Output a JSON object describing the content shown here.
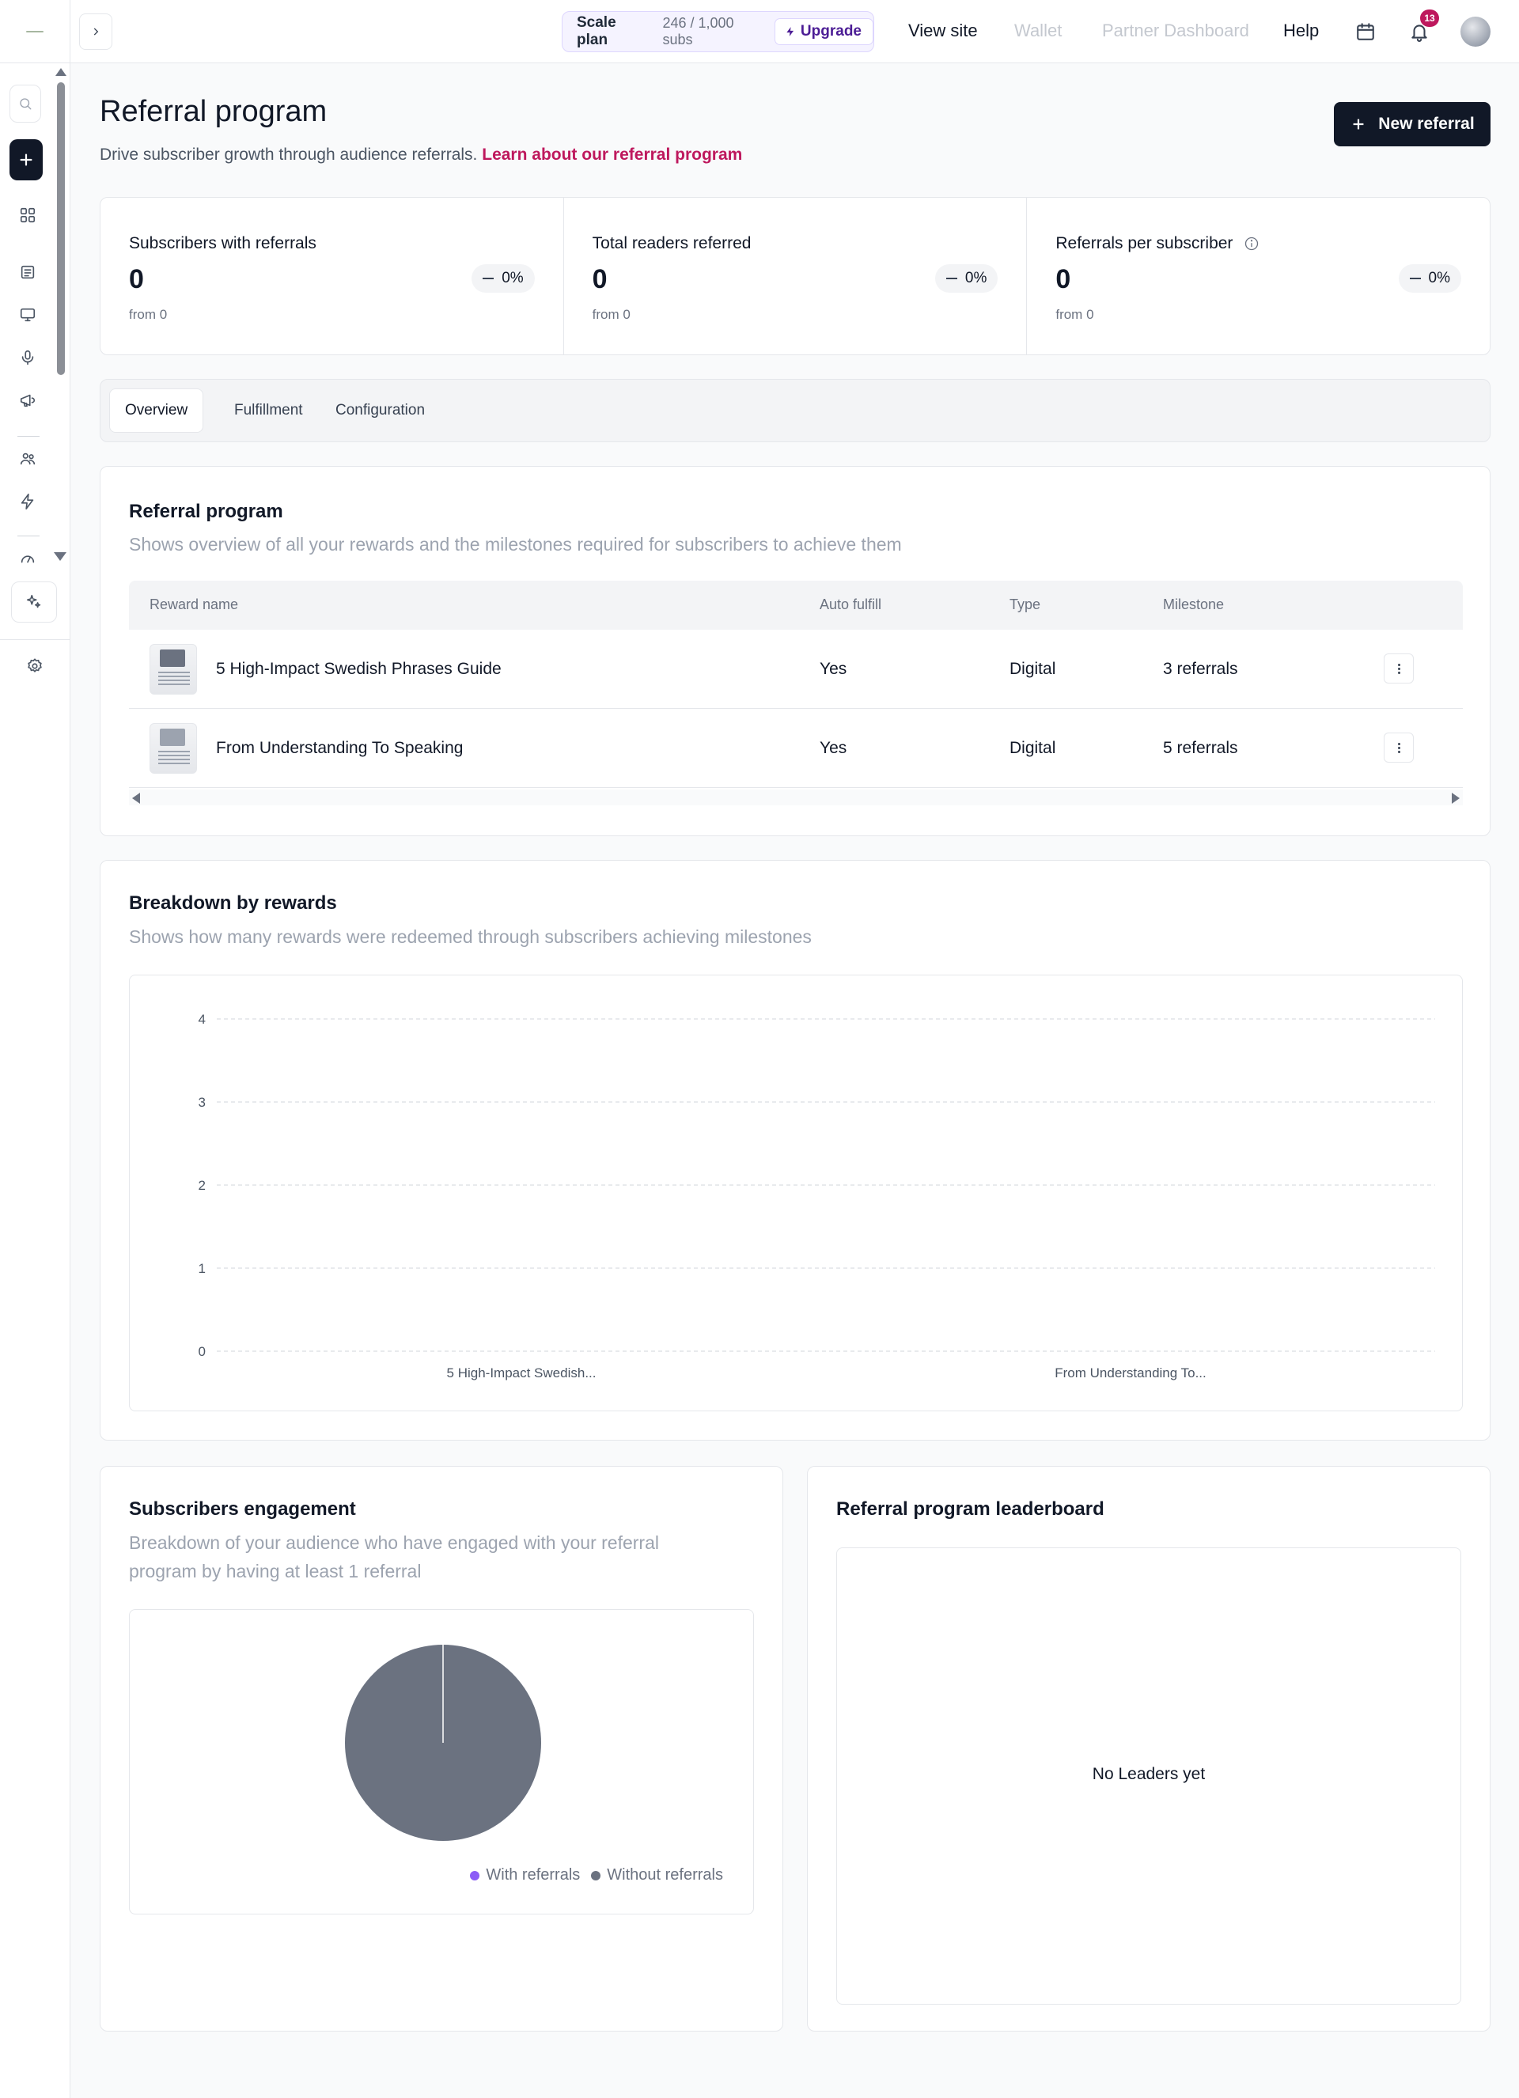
{
  "header": {
    "plan_name": "Scale plan",
    "plan_subs": "246 / 1,000 subs",
    "upgrade_label": "Upgrade",
    "nav": [
      "View site",
      "Wallet",
      "Partner Dashboard",
      "Help"
    ],
    "notification_count": "13"
  },
  "sidebar": {
    "icons": [
      "search-icon",
      "plus-icon",
      "grid-icon",
      "document-icon",
      "monitor-icon",
      "microphone-icon",
      "megaphone-icon",
      "users-icon",
      "lightning-icon",
      "gauge-icon",
      "sparkles-icon",
      "gear-icon"
    ]
  },
  "page": {
    "title": "Referral program",
    "subtitle": "Drive subscriber growth through audience referrals.",
    "learn_link": "Learn about our referral program",
    "new_button": "New referral"
  },
  "stats": [
    {
      "label": "Subscribers with referrals",
      "value": "0",
      "from": "from 0",
      "delta": "0%"
    },
    {
      "label": "Total readers referred",
      "value": "0",
      "from": "from 0",
      "delta": "0%"
    },
    {
      "label": "Referrals per subscriber",
      "value": "0",
      "from": "from 0",
      "delta": "0%"
    }
  ],
  "tabs": [
    "Overview",
    "Fulfillment",
    "Configuration"
  ],
  "referral_program": {
    "title": "Referral program",
    "subtitle": "Shows overview of all your rewards and the milestones required for subscribers to achieve them",
    "columns": [
      "Reward name",
      "Auto fulfill",
      "Type",
      "Milestone"
    ],
    "rows": [
      {
        "name": "5 High-Impact Swedish Phrases Guide",
        "auto": "Yes",
        "type": "Digital",
        "milestone": "3 referrals"
      },
      {
        "name": "From Understanding To Speaking",
        "auto": "Yes",
        "type": "Digital",
        "milestone": "5 referrals"
      }
    ]
  },
  "breakdown": {
    "title": "Breakdown by rewards",
    "subtitle": "Shows how many rewards were redeemed through subscribers achieving milestones"
  },
  "engagement": {
    "title": "Subscribers engagement",
    "subtitle_line1": "Breakdown of your audience who have engaged with your referral",
    "subtitle_line2": "program by having at least 1 referral"
  },
  "leaderboard": {
    "title": "Referral program leaderboard",
    "empty": "No Leaders yet"
  },
  "chart_data": [
    {
      "type": "bar",
      "categories": [
        "5 High-Impact Swedish...",
        "From Understanding To..."
      ],
      "values": [
        0,
        0
      ],
      "yticks": [
        0,
        1,
        2,
        3,
        4
      ],
      "ylim": [
        0,
        4
      ],
      "grid": true
    },
    {
      "type": "pie",
      "labels": [
        "With referrals",
        "Without referrals"
      ],
      "values": [
        0,
        100
      ],
      "colors": [
        "#8b5cf6",
        "#6b7280"
      ],
      "legend": "bottom-right"
    }
  ]
}
